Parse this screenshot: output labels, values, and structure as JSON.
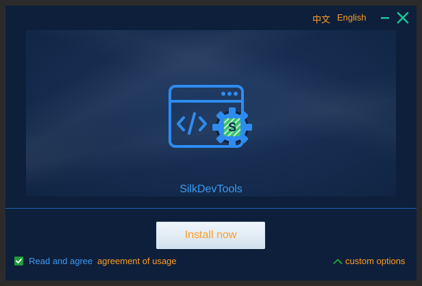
{
  "header": {
    "lang_zh": "中文",
    "lang_en": "English",
    "minimize_icon": "minimize-icon",
    "close_icon": "close-icon"
  },
  "hero": {
    "logo_icon": "code-window-gear-icon",
    "logo_badge": "S",
    "app_name": "SilkDevTools"
  },
  "footer": {
    "install_label": "Install now",
    "agree_checked": true,
    "agree_text": "Read and agree",
    "agree_link": "agreement of usage",
    "custom_label": "custom options"
  },
  "colors": {
    "background": "#0e1f3b",
    "accent_blue": "#3d9bf2",
    "accent_orange": "#ff9d1e",
    "window_button_green": "#19c39a",
    "check_green": "#1f9d3a"
  }
}
